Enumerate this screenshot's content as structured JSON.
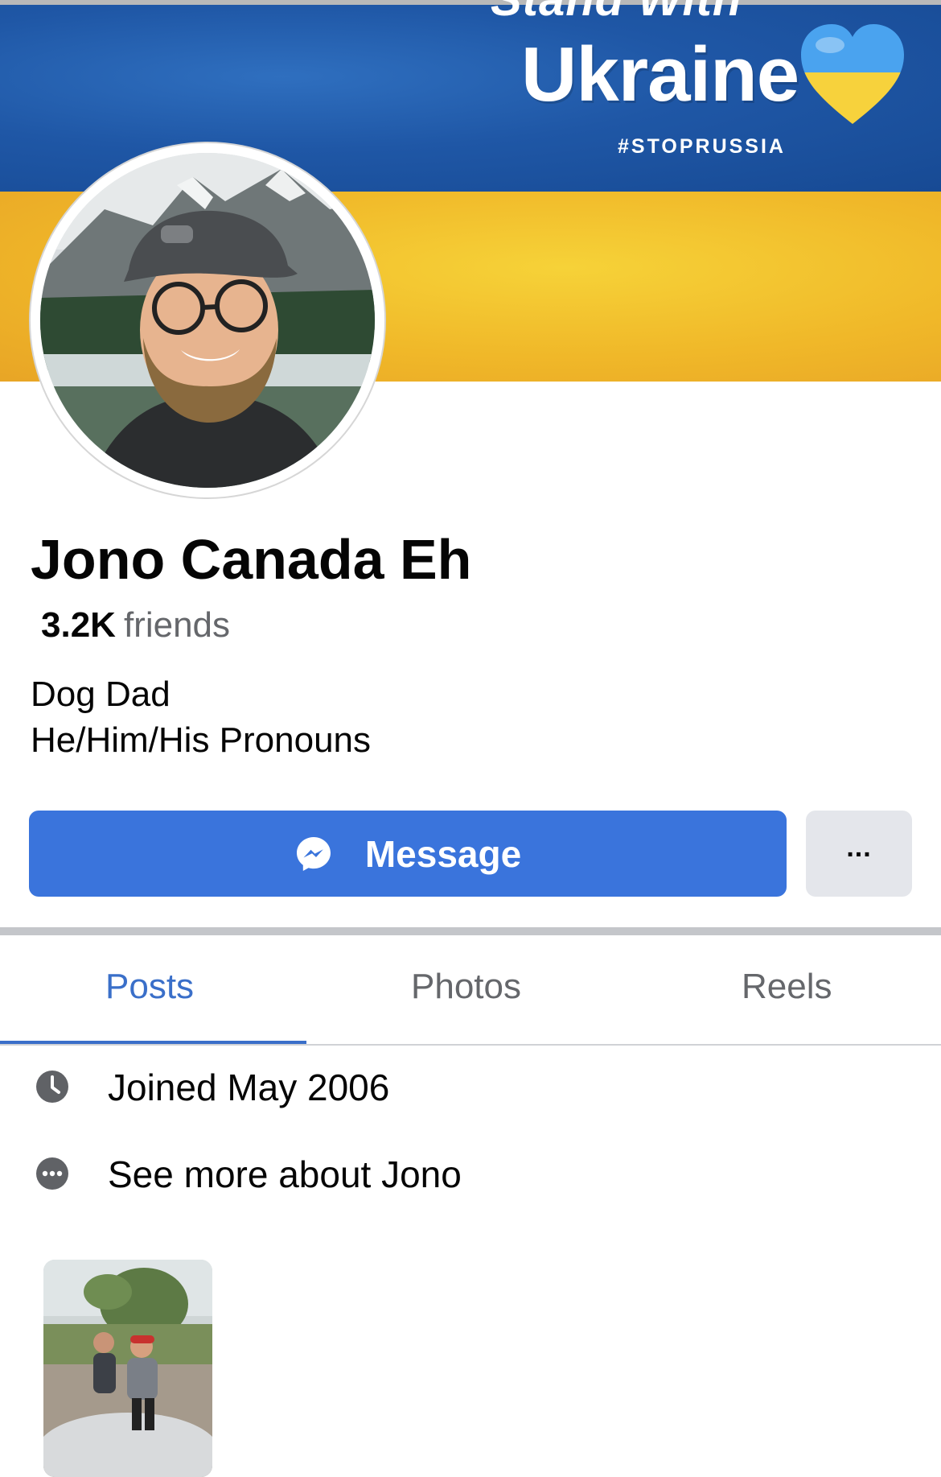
{
  "cover": {
    "slogan_line": "Stand With",
    "country": "Ukraine",
    "hashtag": "#STOPRUSSIA",
    "colors": {
      "blue": "#1f57a6",
      "yellow": "#f0b829"
    }
  },
  "profile": {
    "name": "Jono Canada Eh",
    "friends_count": "3.2K",
    "friends_label": "friends",
    "bio": [
      "Dog Dad",
      "He/Him/His Pronouns"
    ]
  },
  "actions": {
    "message_label": "Message",
    "more_label": "..."
  },
  "tabs": [
    {
      "label": "Posts",
      "active": true
    },
    {
      "label": "Photos",
      "active": false
    },
    {
      "label": "Reels",
      "active": false
    }
  ],
  "details": [
    {
      "icon": "clock-icon",
      "text": "Joined May 2006"
    },
    {
      "icon": "more-dots-icon",
      "text": "See more about Jono"
    }
  ],
  "theme": {
    "accent": "#3a74dc",
    "tab_active": "#3a6fc9",
    "secondary_text": "#65676b"
  }
}
